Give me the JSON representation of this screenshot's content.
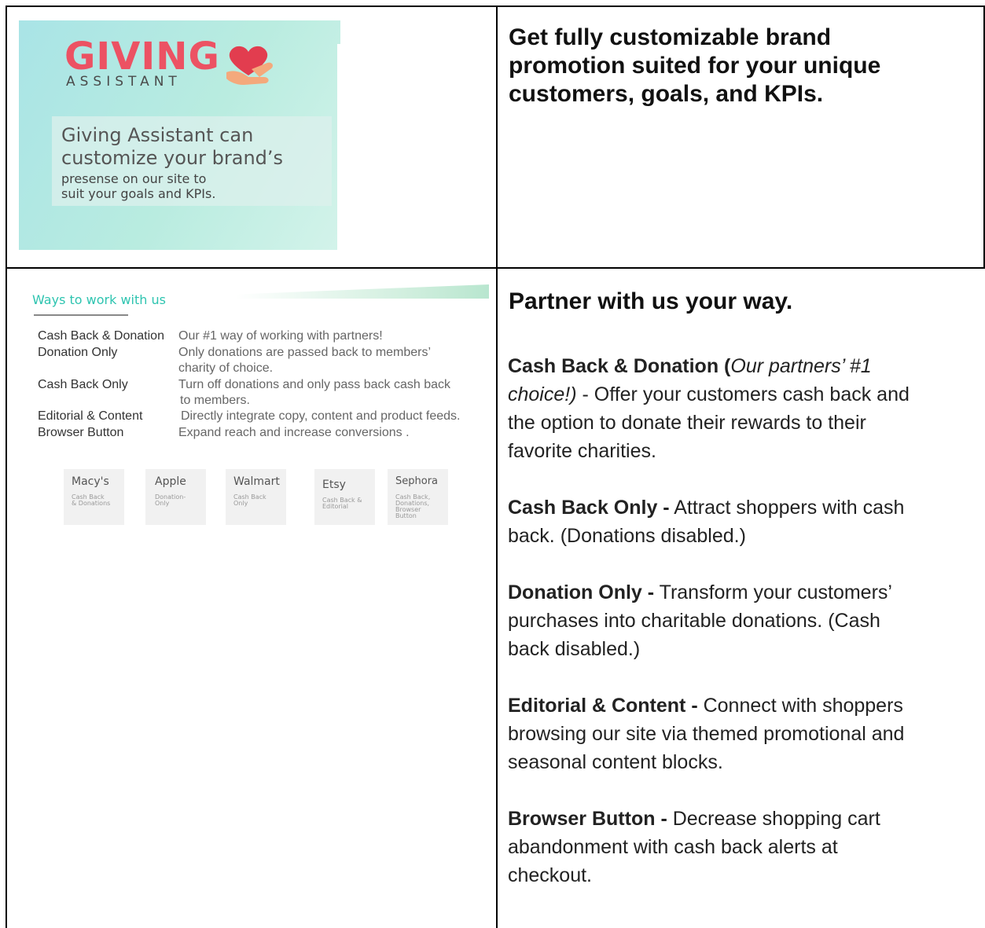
{
  "banner": {
    "logo_word": "GIVING",
    "logo_sub": "ASSISTANT",
    "tagline_lines": [
      "Giving Assistant can",
      "customize your brand’s"
    ],
    "sub_lines": [
      "presense on our site to",
      "suit your goals and KPIs."
    ],
    "colors": {
      "logo_red": "#ec5263",
      "background": "#b9ece0"
    }
  },
  "top_right": {
    "heading_lines": [
      "Get fully customizable brand",
      "promotion suited for your unique",
      "customers, goals, and KPIs."
    ]
  },
  "ways": {
    "title": "Ways to work with us",
    "rows": [
      {
        "name": "Cash Back & Donation",
        "desc_lines": [
          "Our #1 way of working with partners!"
        ]
      },
      {
        "name": "Donation Only",
        "desc_lines": [
          "Only donations are passed back to members’",
          "charity of choice."
        ]
      },
      {
        "name": "Cash Back Only",
        "desc_lines": [
          "Turn off donations and only pass back cash back",
          "to members."
        ]
      },
      {
        "name": "Editorial & Content",
        "desc_lines": [
          "Directly integrate copy, content and product feeds."
        ]
      },
      {
        "name": "Browser Button",
        "desc_lines": [
          "Expand reach and increase conversions ."
        ]
      }
    ],
    "cards": [
      {
        "name": "Macy's",
        "desc_lines": [
          "Cash Back",
          "& Donations"
        ]
      },
      {
        "name": "Apple",
        "desc_lines": [
          "Donation-",
          "Only"
        ]
      },
      {
        "name": "Walmart",
        "desc_lines": [
          "Cash Back",
          "Only"
        ]
      },
      {
        "name": "Etsy",
        "desc_lines": [
          "Cash Back &",
          "Editorial"
        ]
      },
      {
        "name": "Sephora",
        "desc_lines": [
          "Cash Back,",
          "Donations,",
          "Browser",
          "Button"
        ]
      }
    ]
  },
  "bottom_right": {
    "heading": "Partner with us your way.",
    "p1": {
      "bold": "Cash Back & Donation (",
      "italic_1": "Our partners’ #1",
      "italic_2": "choice!)",
      "rest_1": " - Offer your customers cash back and",
      "line_2": "the option to donate their rewards to their",
      "line_3": "favorite charities."
    },
    "p2": {
      "bold": "Cash Back Only -",
      "line_1": " Attract shoppers with cash",
      "line_2": "back. (Donations disabled.)"
    },
    "p3": {
      "bold": "Donation Only -",
      "line_1": " Transform your customers’",
      "line_2": "purchases into charitable donations. (Cash",
      "line_3": "back disabled.)"
    },
    "p4": {
      "bold": "Editorial & Content -",
      "line_1": " Connect with shoppers",
      "line_2": "browsing our site via themed promotional and",
      "line_3": "seasonal content blocks."
    },
    "p5": {
      "bold": "Browser Button -",
      "line_1": " Decrease shopping cart",
      "line_2": "abandonment with cash back alerts at",
      "line_3": "checkout."
    }
  }
}
